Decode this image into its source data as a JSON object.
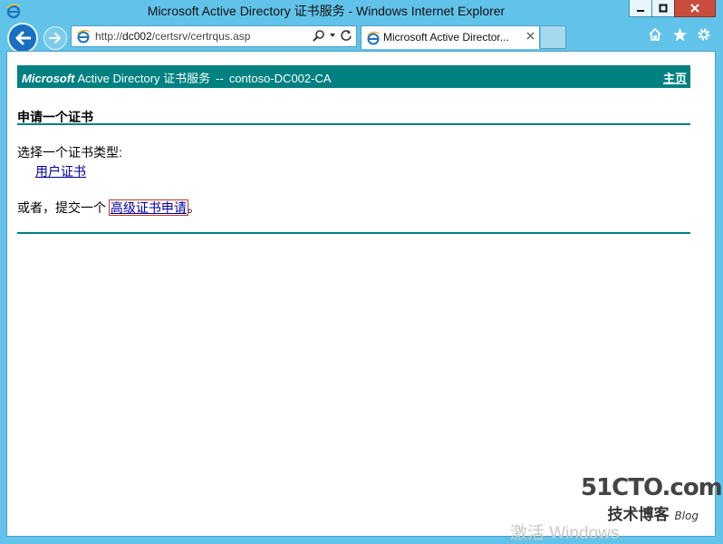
{
  "window": {
    "title": "Microsoft Active Directory 证书服务 - Windows Internet Explorer",
    "minimize": "‒",
    "maximize": "□",
    "close": "✕"
  },
  "address_bar": {
    "url_prefix": "http://",
    "url_host": "dc002",
    "url_path": "/certsrv/certrqus.asp"
  },
  "tab": {
    "label": "Microsoft Active Director...",
    "close": "×"
  },
  "page": {
    "header": {
      "brand": "Microsoft",
      "title": "Active Directory 证书服务",
      "separator": "--",
      "ca_name": "contoso-DC002-CA",
      "home_link": "主页"
    },
    "section_title": "申请一个证书",
    "prompt": "选择一个证书类型:",
    "user_cert_link": "用户证书",
    "or_text": "或者，提交一个",
    "advanced_link": "高级证书申请",
    "period": "。"
  },
  "watermark": {
    "logo": "51CTO.com",
    "sub": "技术博客",
    "blog": "Blog"
  },
  "activate_text": "激活 Windows",
  "colors": {
    "frame": "#62c3ea",
    "header_bar": "#008080",
    "link": "#0000a0"
  }
}
